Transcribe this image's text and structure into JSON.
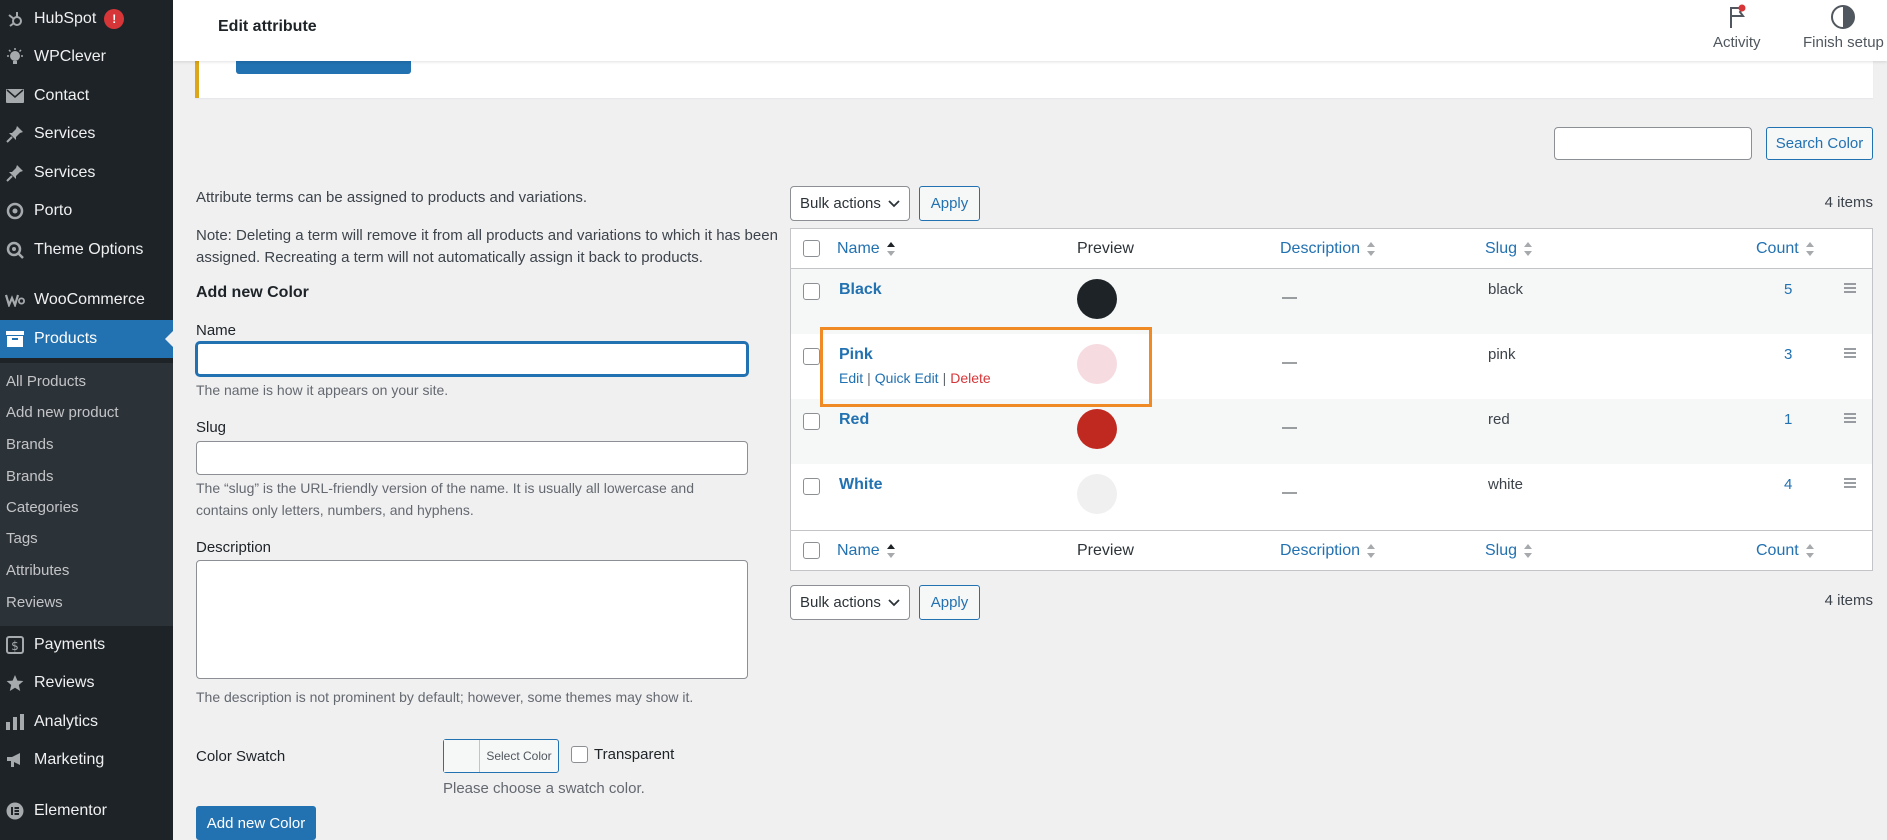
{
  "sidebar": {
    "items": [
      {
        "label": "HubSpot",
        "icon": "hubspot-icon",
        "badge": "!"
      },
      {
        "label": "WPClever",
        "icon": "wpclever-icon"
      },
      {
        "label": "Contact",
        "icon": "mail-icon"
      },
      {
        "label": "Services",
        "icon": "pin-icon"
      },
      {
        "label": "Services",
        "icon": "pin-icon"
      },
      {
        "label": "Porto",
        "icon": "porto-icon"
      },
      {
        "label": "Theme Options",
        "icon": "theme-options-icon"
      },
      {
        "label": "WooCommerce",
        "icon": "woocommerce-icon"
      },
      {
        "label": "Products",
        "icon": "products-icon"
      },
      {
        "label": "Payments",
        "icon": "payments-icon"
      },
      {
        "label": "Reviews",
        "icon": "star-icon"
      },
      {
        "label": "Analytics",
        "icon": "analytics-icon"
      },
      {
        "label": "Marketing",
        "icon": "megaphone-icon"
      },
      {
        "label": "Elementor",
        "icon": "elementor-icon"
      }
    ],
    "submenu": [
      "All Products",
      "Add new product",
      "Brands",
      "Brands",
      "Categories",
      "Tags",
      "Attributes",
      "Reviews"
    ]
  },
  "topbar": {
    "title": "Edit attribute",
    "activity_label": "Activity",
    "finish_setup_label": "Finish setup"
  },
  "form": {
    "intro": "Attribute terms can be assigned to products and variations.",
    "note_line1": "Note: Deleting a term will remove it from all products and variations to which it has been",
    "note_line2": "assigned. Recreating a term will not automatically assign it back to products.",
    "heading": "Add new Color",
    "name_label": "Name",
    "name_value": "",
    "name_help": "The name is how it appears on your site.",
    "slug_label": "Slug",
    "slug_value": "",
    "slug_help_line1": "The “slug” is the URL-friendly version of the name. It is usually all lowercase and",
    "slug_help_line2": "contains only letters, numbers, and hyphens.",
    "description_label": "Description",
    "description_value": "",
    "description_help": "The description is not prominent by default; however, some themes may show it.",
    "swatch_label": "Color Swatch",
    "select_color_label": "Select Color",
    "transparent_label": "Transparent",
    "swatch_help": "Please choose a swatch color.",
    "submit_label": "Add new Color"
  },
  "list": {
    "search_value": "",
    "search_button": "Search Color",
    "bulk_actions_label": "Bulk actions",
    "apply_label": "Apply",
    "items_count": "4 items",
    "columns": {
      "name": "Name",
      "preview": "Preview",
      "description": "Description",
      "slug": "Slug",
      "count": "Count"
    },
    "row_actions": {
      "edit": "Edit",
      "quick_edit": "Quick Edit",
      "delete": "Delete",
      "separator": "|"
    },
    "rows": [
      {
        "name": "Black",
        "color": "#1d2327",
        "description": "—",
        "slug": "black",
        "count": "5"
      },
      {
        "name": "Pink",
        "color": "#f6dbe0",
        "description": "—",
        "slug": "pink",
        "count": "3"
      },
      {
        "name": "Red",
        "color": "#c0291f",
        "description": "—",
        "slug": "red",
        "count": "1"
      },
      {
        "name": "White",
        "color": "#f0f0f1",
        "description": "—",
        "slug": "white",
        "count": "4"
      }
    ]
  },
  "colors": {
    "accent": "#2271b1",
    "sidebar_bg": "#1d2327",
    "highlight": "#f08a24",
    "danger": "#d63638"
  }
}
